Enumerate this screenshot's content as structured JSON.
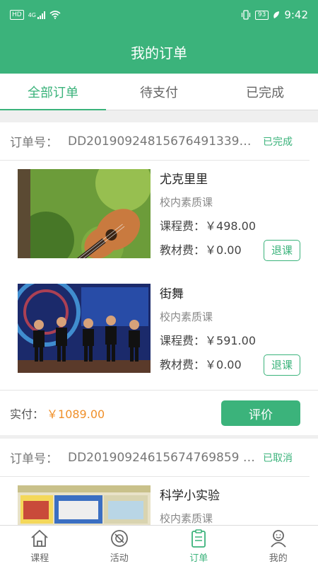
{
  "status_bar": {
    "hd": "HD",
    "network": "4G",
    "battery": "93",
    "time": "9:42"
  },
  "header": {
    "title": "我的订单"
  },
  "tabs": [
    {
      "label": "全部订单",
      "active": true
    },
    {
      "label": "待支付",
      "active": false
    },
    {
      "label": "已完成",
      "active": false
    }
  ],
  "orders": [
    {
      "order_no_label": "订单号：",
      "order_no": "DD20190924815676491339Of...",
      "status": "已完成",
      "courses": [
        {
          "name": "尤克里里",
          "type": "校内素质课",
          "course_fee_label": "课程费：",
          "course_fee": "￥498.00",
          "material_fee_label": "教材费：",
          "material_fee": "￥0.00",
          "action": "退课"
        },
        {
          "name": "街舞",
          "type": "校内素质课",
          "course_fee_label": "课程费：",
          "course_fee": "￥591.00",
          "material_fee_label": "教材费：",
          "material_fee": "￥0.00",
          "action": "退课"
        }
      ],
      "paid_label": "实付：",
      "paid_value": "￥1089.00",
      "review_label": "评价"
    },
    {
      "order_no_label": "订单号：",
      "order_no": "DD20190924615674769859 47...",
      "status": "已取消",
      "courses": [
        {
          "name": "科学小实验",
          "type": "校内素质课"
        }
      ]
    }
  ],
  "bottom_nav": [
    {
      "label": "课程",
      "icon": "home-icon",
      "active": false
    },
    {
      "label": "活动",
      "icon": "activity-icon",
      "active": false
    },
    {
      "label": "订单",
      "icon": "clipboard-icon",
      "active": true
    },
    {
      "label": "我的",
      "icon": "user-icon",
      "active": false
    }
  ],
  "colors": {
    "primary": "#3bb37b",
    "price": "#f0902a"
  }
}
